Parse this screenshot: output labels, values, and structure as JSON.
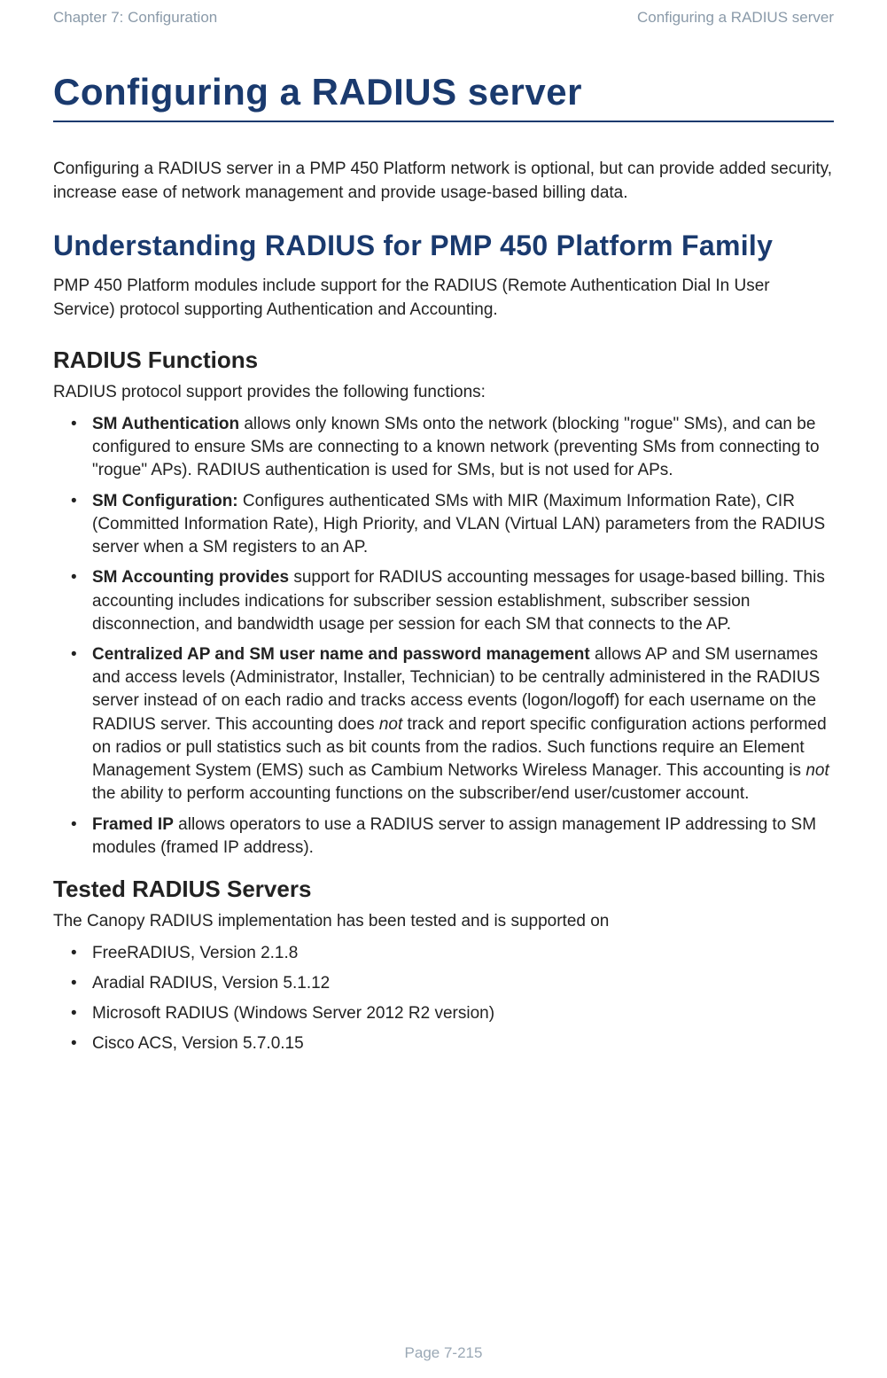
{
  "header": {
    "left": "Chapter 7:  Configuration",
    "right": "Configuring a RADIUS server"
  },
  "title": "Configuring a RADIUS server",
  "intro": "Configuring a RADIUS server in a PMP 450 Platform network is optional, but can provide added security, increase ease of network management and provide usage-based billing data.",
  "section1": {
    "heading": "Understanding RADIUS for PMP 450 Platform Family",
    "body": "PMP 450 Platform modules include support for the RADIUS (Remote Authentication Dial In User Service) protocol supporting Authentication and Accounting."
  },
  "functions": {
    "heading": "RADIUS Functions",
    "lead": "RADIUS protocol support provides the following functions:",
    "items": [
      {
        "bold": "SM Authentication",
        "rest": " allows only known SMs onto the network (blocking \"rogue\" SMs), and can be configured to ensure SMs are connecting to a known network (preventing SMs from connecting to \"rogue\" APs). RADIUS authentication is used for SMs, but is not used for APs."
      },
      {
        "bold": "SM Configuration:",
        "rest": " Configures authenticated SMs with MIR (Maximum Information Rate), CIR (Committed Information Rate), High Priority, and VLAN (Virtual LAN) parameters from the RADIUS server when a SM registers to an AP."
      },
      {
        "bold": "SM Accounting provides",
        "rest": " support for RADIUS accounting messages for usage-based billing. This accounting includes indications for subscriber session establishment, subscriber session disconnection, and bandwidth usage per session for each SM that connects to the AP."
      },
      {
        "bold": "Centralized AP and SM user name and password management",
        "rest_pre": " allows AP and SM usernames and access levels (Administrator, Installer, Technician) to be centrally administered in the RADIUS server instead of on each radio and tracks access events (logon/logoff) for each username on the RADIUS server. This accounting does ",
        "ital1": "not",
        "rest_mid": " track and report specific configuration actions performed on radios or pull statistics such as bit counts from the radios. Such functions require an Element Management System (EMS) such as Cambium Networks Wireless Manager. This accounting is ",
        "ital2": "not",
        "rest_post": " the ability to perform accounting functions on the subscriber/end user/customer account."
      },
      {
        "bold": "Framed IP",
        "rest": " allows operators to use a RADIUS server to assign management IP addressing to SM modules (framed IP address)."
      }
    ]
  },
  "tested": {
    "heading": "Tested RADIUS Servers",
    "lead": "The Canopy RADIUS implementation has been tested and is supported on",
    "items": [
      "FreeRADIUS, Version 2.1.8",
      "Aradial RADIUS, Version 5.1.12",
      "Microsoft RADIUS (Windows Server 2012 R2 version)",
      "Cisco ACS, Version 5.7.0.15"
    ]
  },
  "footer": "Page 7-215"
}
